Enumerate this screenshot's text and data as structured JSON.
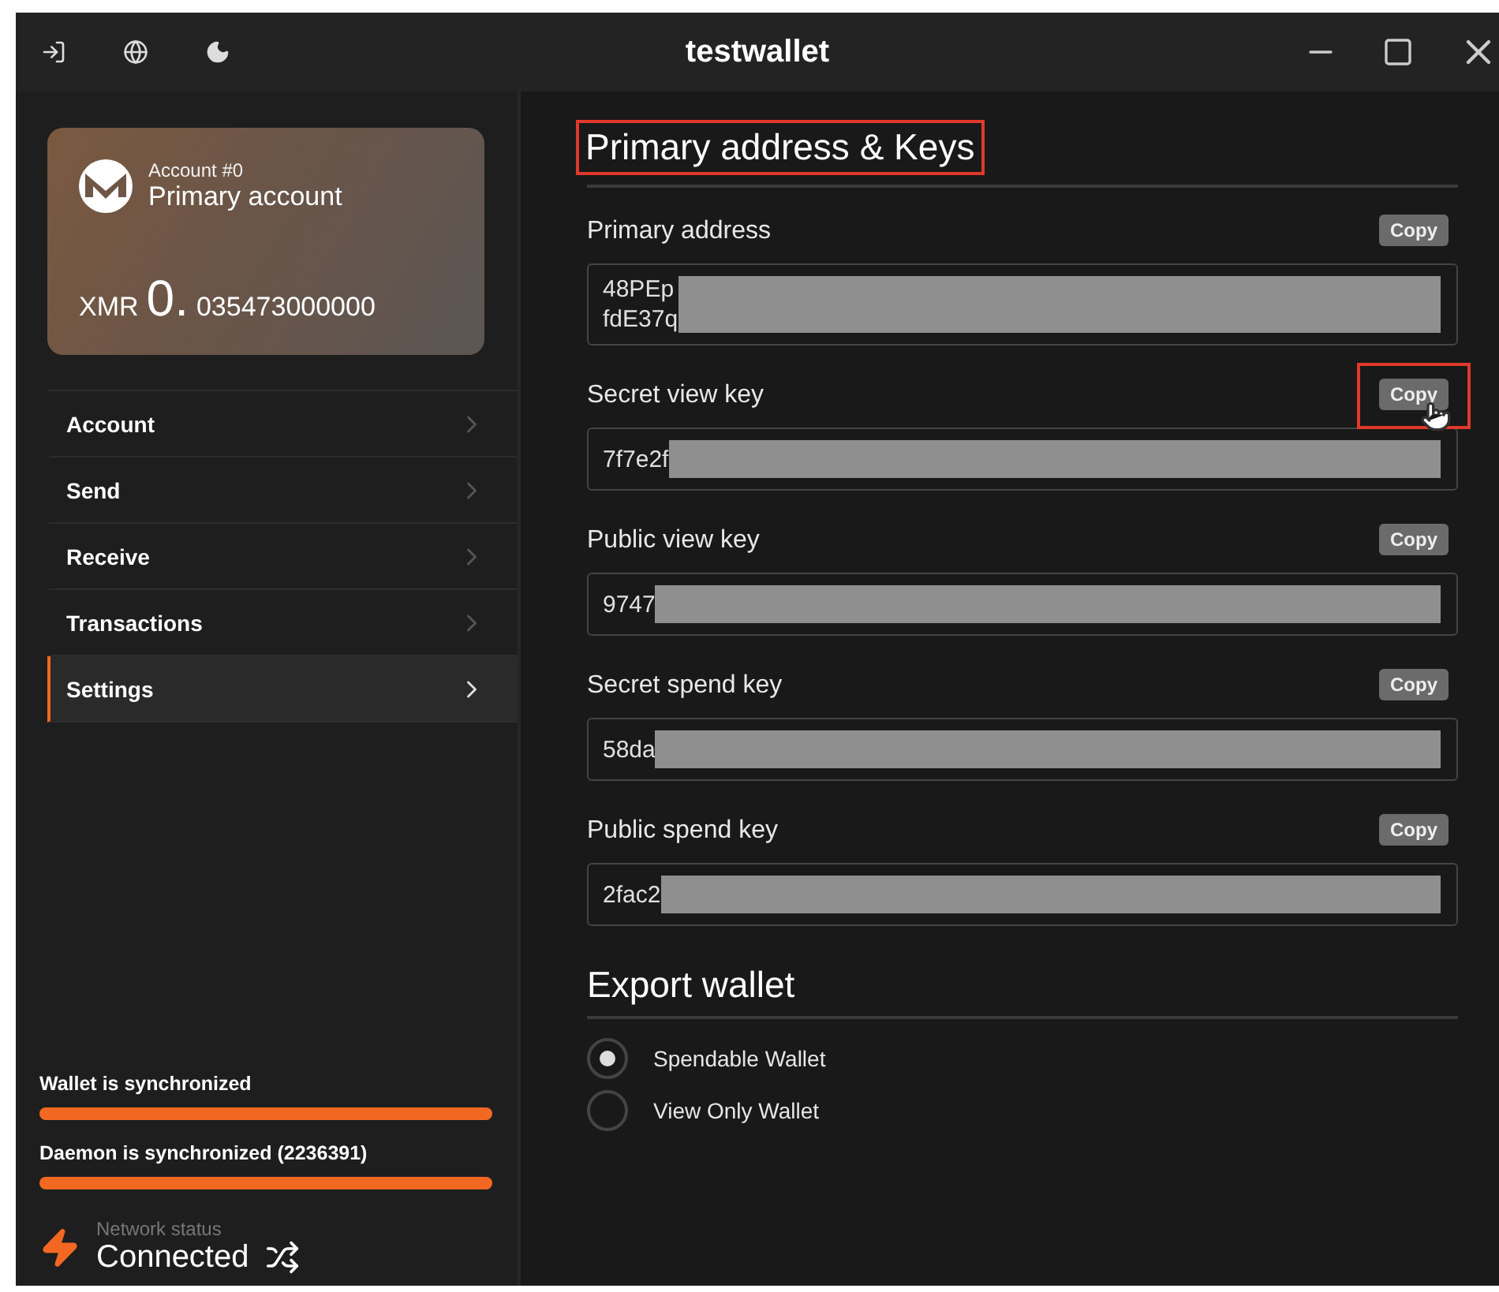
{
  "window": {
    "title": "testwallet"
  },
  "account_card": {
    "account_number": "Account #0",
    "account_name": "Primary account",
    "currency": "XMR",
    "balance_integer": "0.",
    "balance_fraction": "035473000000"
  },
  "sidebar": {
    "items": [
      {
        "label": "Account",
        "selected": false
      },
      {
        "label": "Send",
        "selected": false
      },
      {
        "label": "Receive",
        "selected": false
      },
      {
        "label": "Transactions",
        "selected": false
      },
      {
        "label": "Settings",
        "selected": true
      }
    ]
  },
  "sync": [
    {
      "label": "Wallet is synchronized",
      "level": 1
    },
    {
      "label": "Daemon is synchronized (2236391)",
      "level": 1
    }
  ],
  "network": {
    "label": "Network status",
    "status": "Connected"
  },
  "keys_section": {
    "heading": "Primary address & Keys",
    "highlighted": true,
    "keys": [
      {
        "label": "Primary address",
        "copy_label": "Copy",
        "highlighted": false,
        "value_lines": [
          "48PEp",
          "fdE37q"
        ],
        "redacted": true
      },
      {
        "label": "Secret view key",
        "copy_label": "Copy",
        "highlighted": true,
        "value_lines": [
          "7f7e2f"
        ],
        "redacted": true
      },
      {
        "label": "Public view key",
        "copy_label": "Copy",
        "highlighted": false,
        "value_lines": [
          "9747"
        ],
        "redacted": true
      },
      {
        "label": "Secret spend key",
        "copy_label": "Copy",
        "highlighted": false,
        "value_lines": [
          "58da"
        ],
        "redacted": true
      },
      {
        "label": "Public spend key",
        "copy_label": "Copy",
        "highlighted": false,
        "value_lines": [
          "2fac2"
        ],
        "redacted": true
      }
    ]
  },
  "export_section": {
    "heading": "Export wallet",
    "options": [
      {
        "label": "Spendable Wallet",
        "selected": true
      },
      {
        "label": "View Only Wallet",
        "selected": false
      }
    ]
  }
}
